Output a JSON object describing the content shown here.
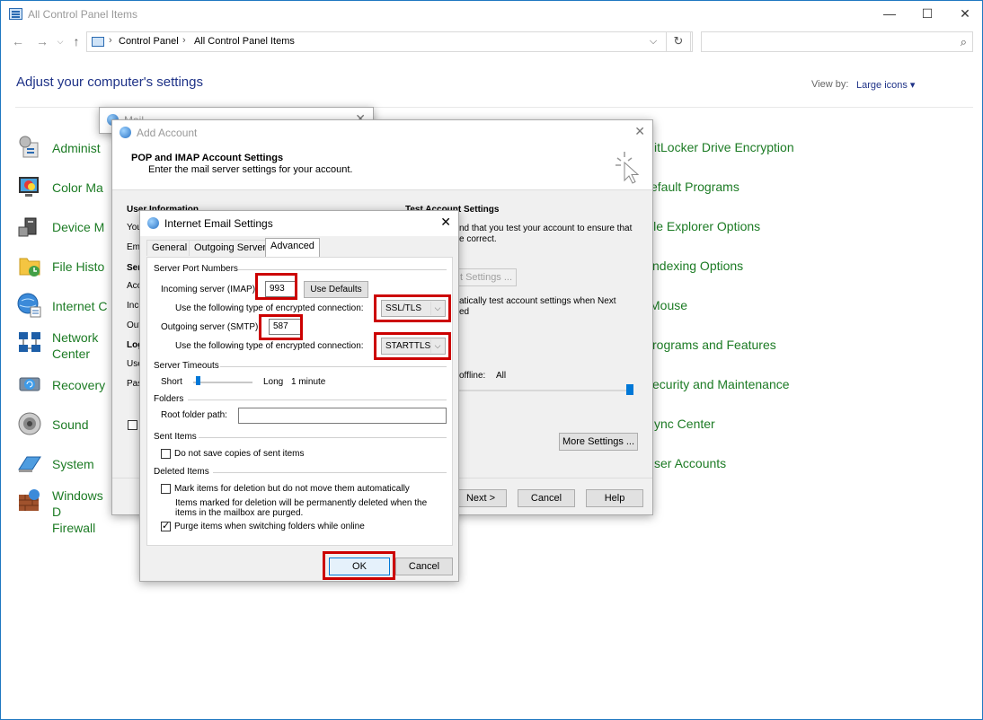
{
  "window": {
    "title": "All Control Panel Items",
    "controls": {
      "minimize": "—",
      "maximize": "☐",
      "close": "✕"
    }
  },
  "address": {
    "crumbs": [
      "Control Panel",
      "All Control Panel Items"
    ],
    "separator": "›",
    "search_placeholder": ""
  },
  "header": {
    "heading": "Adjust your computer's settings",
    "view_by_label": "View by:",
    "view_by_value": "Large icons ▾"
  },
  "left_items": [
    {
      "label": "Administ",
      "icon": "admin-tools-icon"
    },
    {
      "label": "Color Ma",
      "icon": "color-management-icon"
    },
    {
      "label": "Device M",
      "icon": "device-manager-icon"
    },
    {
      "label": "File Histo",
      "icon": "file-history-icon"
    },
    {
      "label": "Internet C",
      "icon": "internet-options-icon"
    },
    {
      "label": "Network\nCenter",
      "icon": "network-icon"
    },
    {
      "label": "Recovery",
      "icon": "recovery-icon"
    },
    {
      "label": "Sound",
      "icon": "sound-icon"
    },
    {
      "label": "System",
      "icon": "system-icon"
    },
    {
      "label": "Windows D\nFirewall",
      "icon": "firewall-icon"
    }
  ],
  "right_items": [
    "itLocker Drive Encryption",
    "efault Programs",
    "ile Explorer Options",
    "ndexing Options",
    "Mouse",
    "rograms and Features",
    "ecurity and Maintenance",
    "ync Center",
    "ser Accounts"
  ],
  "mail_dialog": {
    "title": "Mail",
    "close": "✕"
  },
  "add_account": {
    "title": "Add Account",
    "close": "✕",
    "heading": "POP and IMAP Account Settings",
    "subheading": "Enter the mail server settings for your account.",
    "user_information": "User Information",
    "partial_labels": [
      "You",
      "Ema",
      "Serv",
      "Acc",
      "Inco",
      "Out",
      "Log",
      "Use",
      "Pas"
    ],
    "test_settings_heading": "Test Account Settings",
    "test_text_1": "nd that you test your account to ensure that",
    "test_text_2": "e correct.",
    "test_button": "t Settings ...",
    "auto_test_1": "atically test account settings when Next",
    "auto_test_2": "ed",
    "offline_label": "offline:",
    "offline_value": "All",
    "more_settings": "More Settings ...",
    "next": "Next >",
    "cancel": "Cancel",
    "help": "Help"
  },
  "ies": {
    "title": "Internet Email Settings",
    "close": "✕",
    "tabs": [
      "General",
      "Outgoing Server",
      "Advanced"
    ],
    "server_ports": "Server Port Numbers",
    "incoming_label": "Incoming server (IMAP):",
    "incoming_value": "993",
    "use_defaults": "Use Defaults",
    "encrypt_label_1": "Use the following type of encrypted connection:",
    "encrypt_value_1": "SSL/TLS",
    "outgoing_label": "Outgoing server (SMTP):",
    "outgoing_value": "587",
    "encrypt_label_2": "Use the following type of encrypted connection:",
    "encrypt_value_2": "STARTTLS",
    "timeouts": "Server Timeouts",
    "short": "Short",
    "long": "Long",
    "timeout_value": "1 minute",
    "timeout_level": 0.05,
    "folders": "Folders",
    "root_folder_label": "Root folder path:",
    "root_folder_value": "",
    "sent_items": "Sent Items",
    "dont_save_sent": "Do not save copies of sent items",
    "deleted_items": "Deleted Items",
    "mark_deleted": "Mark items for deletion but do not move them automatically",
    "mark_note_1": "Items marked for deletion will be permanently deleted when the",
    "mark_note_2": "items in the mailbox are purged.",
    "purge": "Purge items when switching folders while online",
    "ok": "OK",
    "cancel": "Cancel"
  },
  "colors": {
    "link_green": "#1c7b24",
    "heading_blue": "#1e3287",
    "highlight_red": "#cc0000",
    "accent": "#0078d7"
  }
}
